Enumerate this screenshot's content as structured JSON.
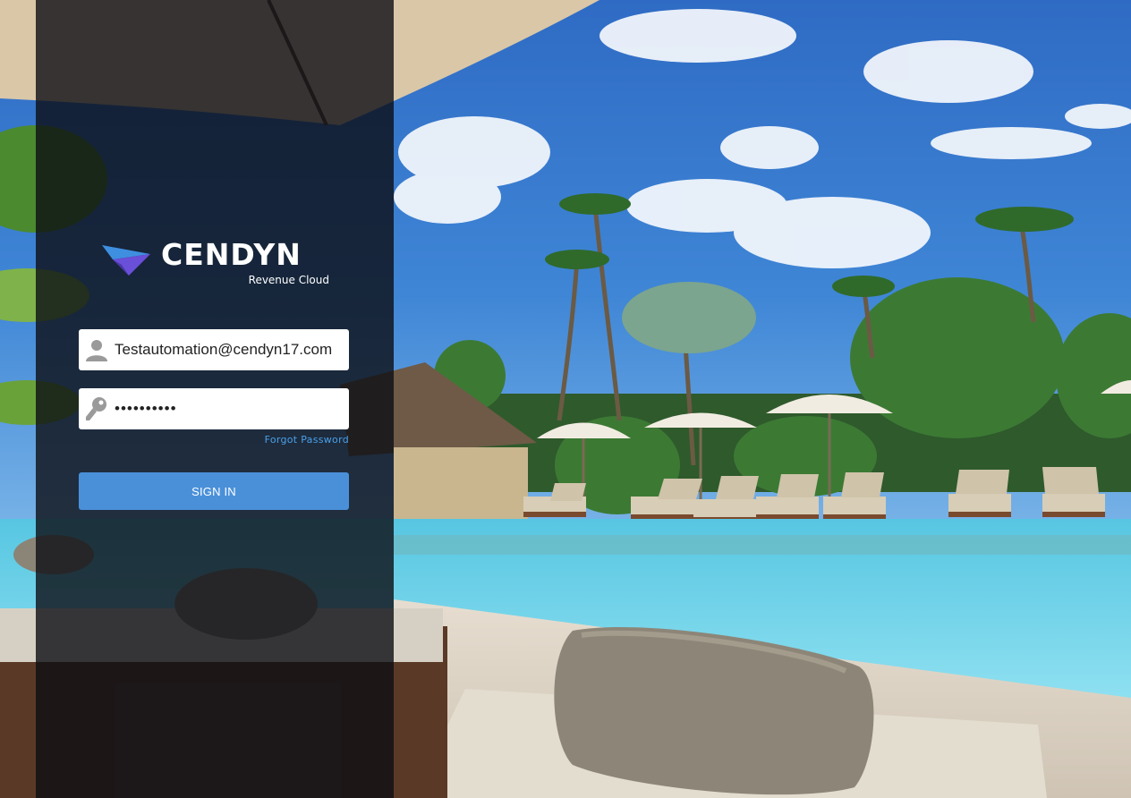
{
  "brand": {
    "name": "CENDYN",
    "tagline": "Revenue Cloud"
  },
  "login": {
    "email_value": "Testautomation@cendyn17.com",
    "password_value": "••••••••••",
    "forgot_password_label": "Forgot Password",
    "signin_label": "SIGN IN"
  },
  "icons": {
    "user": "user-icon",
    "password": "key-icon",
    "logo": "cendyn-logo-mark"
  },
  "colors": {
    "primary": "#4a90d9",
    "link": "#4aa0e8",
    "panel": "#0c0e14"
  }
}
